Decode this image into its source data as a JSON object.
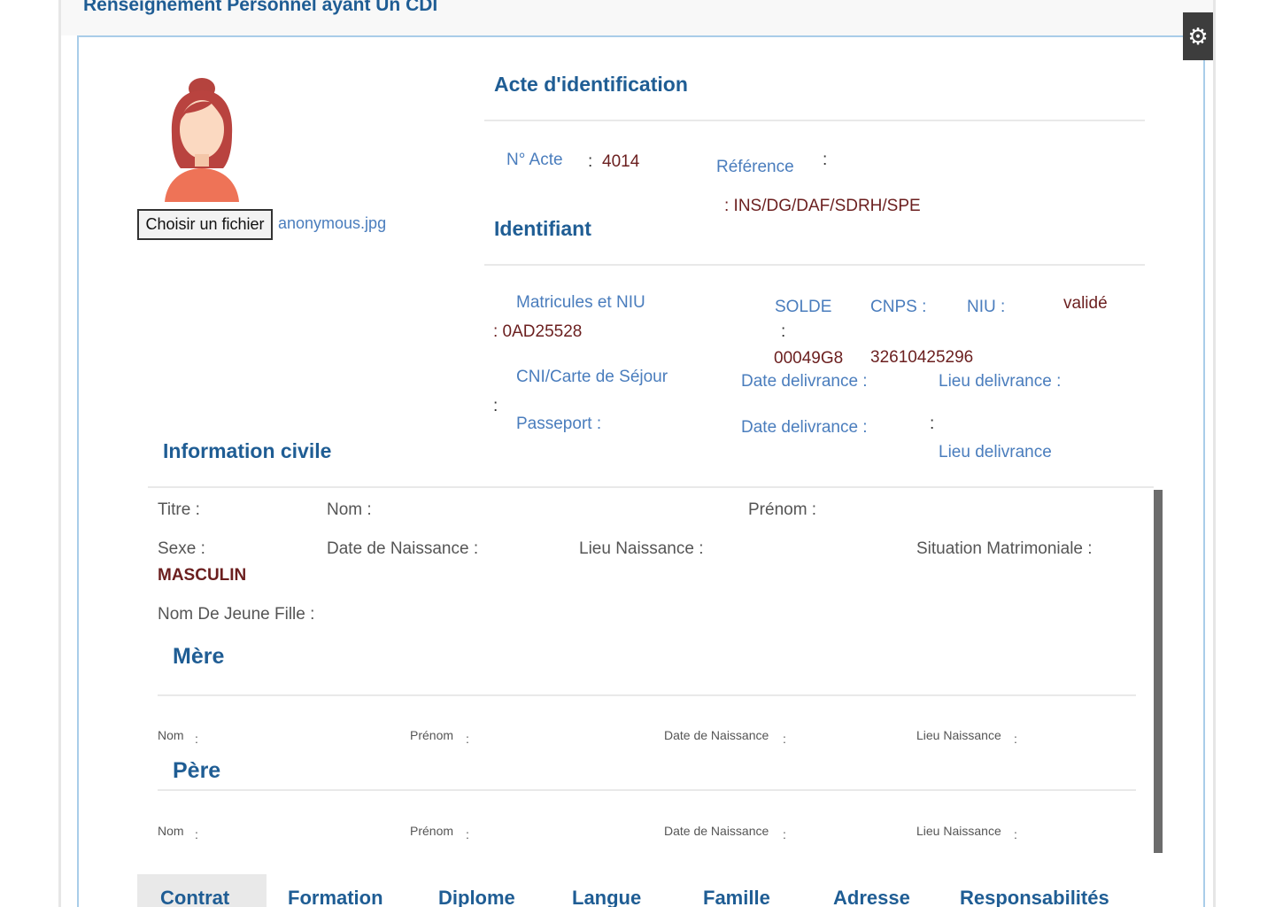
{
  "page_title": "Renseignement Personnel ayant Un CDI",
  "settings_icon": "gear-icon",
  "photo": {
    "avatar_icon": "female-avatar-icon",
    "file_button": "Choisir un fichier",
    "file_name": "anonymous.jpg"
  },
  "acte": {
    "title": "Acte d'identification",
    "no_acte_label": "N° Acte",
    "colon": ":",
    "no_acte_value": "4014",
    "reference_label": "Référence",
    "reference_value": ": INS/DG/DAF/SDRH/SPE"
  },
  "identifiant": {
    "title": "Identifiant",
    "matricules_label": "Matricules et NIU",
    "matricules_value": ": 0AD25528",
    "solde_label": "SOLDE",
    "solde_colon": ":",
    "solde_value": "00049G8",
    "cnps_label": "CNPS :",
    "cnps_value": "32610425296",
    "niu_label": "NIU :",
    "status": "validé",
    "cni_label": "CNI/Carte de Séjour",
    "cni_colon": ":",
    "cni_date_label": "Date delivrance :",
    "cni_lieu_label": "Lieu delivrance :",
    "passeport_label": "Passeport :",
    "pass_date_label": "Date delivrance :",
    "pass_lieu_colon": ":",
    "pass_lieu_label": "Lieu delivrance"
  },
  "civil": {
    "title": "Information civile",
    "titre_label": "Titre :",
    "nom_label": "Nom :",
    "prenom_label": "Prénom :",
    "sexe_label": "Sexe :",
    "sexe_value": "MASCULIN",
    "date_naissance_label": "Date de Naissance :",
    "lieu_naissance_label": "Lieu Naissance :",
    "situation_label": "Situation Matrimoniale :",
    "jeune_fille_label": "Nom De Jeune Fille :"
  },
  "mere": {
    "title": "Mère",
    "nom_label": "Nom",
    "prenom_label": "Prénom",
    "date_label": "Date de Naissance",
    "lieu_label": "Lieu Naissance",
    "colon": ":"
  },
  "pere": {
    "title": "Père",
    "nom_label": "Nom",
    "prenom_label": "Prénom",
    "date_label": "Date de Naissance",
    "lieu_label": "Lieu Naissance",
    "colon": ":"
  },
  "tabs": [
    "Contrat",
    "Formation",
    "Diplome",
    "Langue",
    "Famille",
    "Adresse",
    "Responsabilités"
  ],
  "active_tab": "Contrat"
}
